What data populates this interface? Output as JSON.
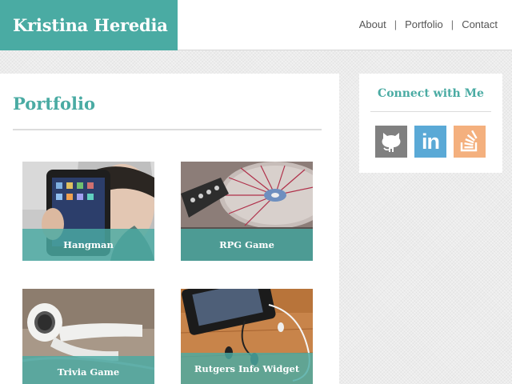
{
  "header": {
    "brand": "Kristina Heredia",
    "nav": [
      {
        "label": "About"
      },
      {
        "label": "Portfolio"
      },
      {
        "label": "Contact"
      }
    ],
    "separator": "|"
  },
  "main": {
    "title": "Portfolio",
    "projects": [
      {
        "label": "Hangman"
      },
      {
        "label": "RPG Game"
      },
      {
        "label": "Trivia Game"
      },
      {
        "label": "Rutgers Info Widget"
      }
    ]
  },
  "sidebar": {
    "title": "Connect with Me",
    "social": [
      {
        "icon": "github-icon",
        "color": "#808080"
      },
      {
        "icon": "linkedin-icon",
        "color": "#5aa9d6",
        "text": "in"
      },
      {
        "icon": "stackoverflow-icon",
        "color": "#f4b07e"
      }
    ]
  },
  "colors": {
    "accent": "#4aaba3",
    "background": "#ececec",
    "nav_text": "#555555"
  }
}
